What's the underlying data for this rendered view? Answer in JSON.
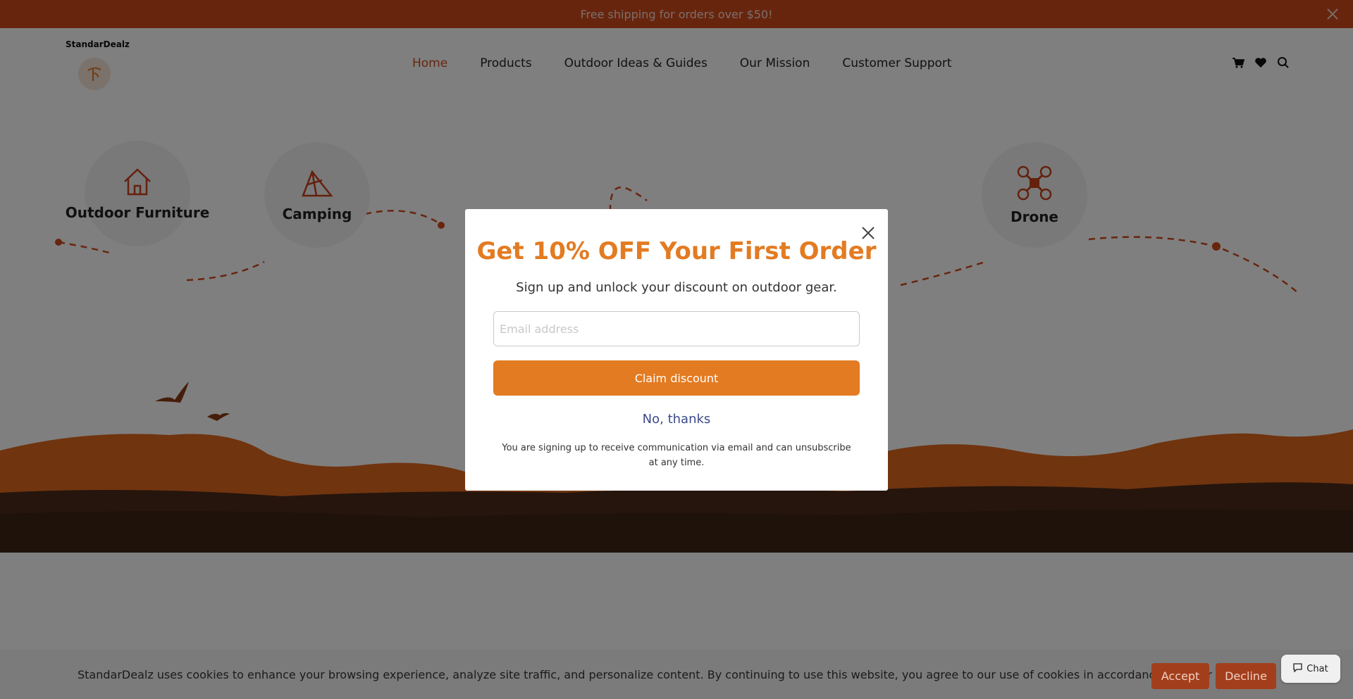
{
  "announcement": {
    "text": "Free shipping for orders over $50!",
    "close_icon": "close-icon"
  },
  "brand": {
    "name": "StandarDealz"
  },
  "nav": {
    "items": [
      {
        "label": "Home",
        "active": true
      },
      {
        "label": "Products",
        "active": false
      },
      {
        "label": "Outdoor Ideas & Guides",
        "active": false
      },
      {
        "label": "Our Mission",
        "active": false
      },
      {
        "label": "Customer Support",
        "active": false
      }
    ],
    "icons": [
      "cart-icon",
      "heart-icon",
      "search-icon"
    ]
  },
  "categories": [
    {
      "label": "Outdoor Furniture",
      "icon": "house-icon"
    },
    {
      "label": "Camping",
      "icon": "tent-icon"
    },
    {
      "label": "Drone",
      "icon": "drone-icon"
    }
  ],
  "popup": {
    "title": "Get 10% OFF Your First Order",
    "subtitle": "Sign up and unlock your discount on outdoor gear.",
    "email_placeholder": "Email address",
    "email_value": "",
    "claim_label": "Claim discount",
    "decline_label": "No, thanks",
    "disclaimer": "You are signing up to receive communication via email and can unsubscribe at any time."
  },
  "cookie_banner": {
    "text": "StandarDealz uses cookies to enhance your browsing experience, analyze site traffic, and personalize content. By continuing to use this website, you agree to our use of cookies in accordance with our policy.",
    "accept_label": "Accept",
    "decline_label": "Decline"
  },
  "chat": {
    "label": "Chat"
  },
  "colors": {
    "accent": "#d14a1c",
    "cta": "#e37b22",
    "link": "#3b4a8c"
  }
}
